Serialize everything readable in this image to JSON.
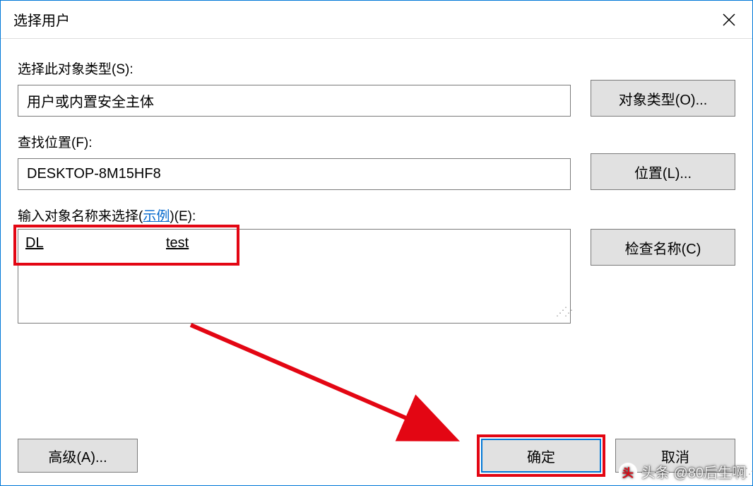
{
  "window": {
    "title": "选择用户"
  },
  "object_type": {
    "label": "选择此对象类型(S):",
    "value": "用户或内置安全主体",
    "button": "对象类型(O)..."
  },
  "location": {
    "label": "查找位置(F):",
    "value": "DESKTOP-8M15HF8",
    "button": "位置(L)..."
  },
  "object_name": {
    "label_prefix": "输入对象名称来选择(",
    "link": "示例",
    "label_suffix": ")(E):",
    "entered_prefix": "DL",
    "entered_suffix": "test",
    "button": "检查名称(C)"
  },
  "footer": {
    "advanced": "高级(A)...",
    "ok": "确定",
    "cancel": "取消"
  },
  "watermark": "头条 @80后生啊"
}
